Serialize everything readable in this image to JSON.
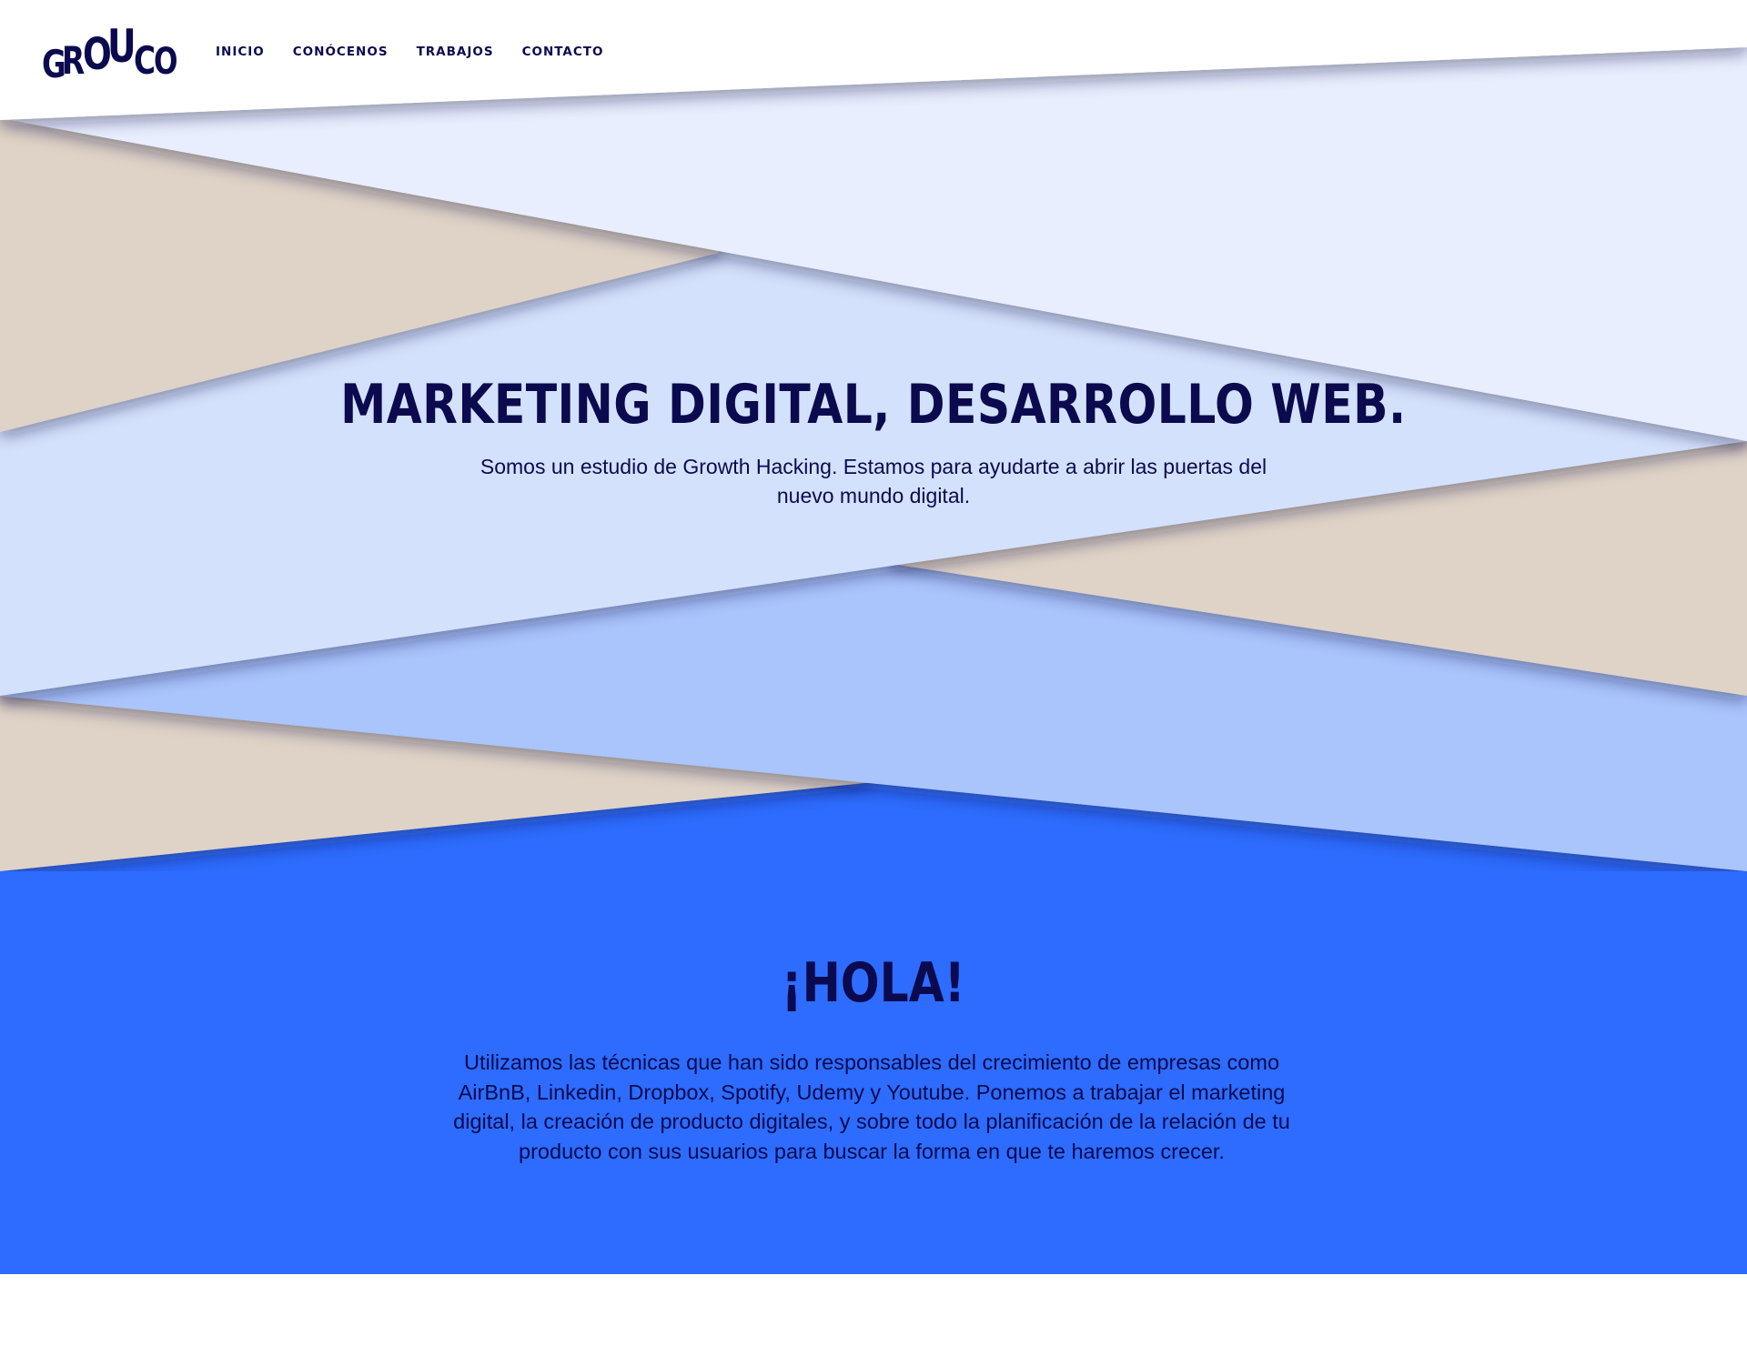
{
  "brand": {
    "logo_letters": [
      "G",
      "R",
      "O",
      "U",
      "C",
      "O"
    ]
  },
  "nav": {
    "items": [
      {
        "label": "INICIO"
      },
      {
        "label": "CONÓCENOS"
      },
      {
        "label": "TRABAJOS"
      },
      {
        "label": "CONTACTO"
      }
    ]
  },
  "hero": {
    "title": "MARKETING DIGITAL, DESARROLLO WEB.",
    "subtitle": "Somos un estudio de Growth Hacking. Estamos para ayudarte a abrir las puertas del nuevo mundo digital."
  },
  "hola": {
    "title": "¡HOLA!",
    "text": "Utilizamos las técnicas que han sido responsables del crecimiento de empresas como AirBnB, Linkedin, Dropbox, Spotify, Udemy y Youtube. Ponemos a trabajar el marketing digital, la creación de producto digitales, y sobre todo la planificación de la relación de tu producto con sus usuarios para buscar la forma en que te haremos crecer."
  },
  "colors": {
    "navy": "#0b0a4e",
    "blue": "#2d6cff",
    "light_blue": "#aac4fc",
    "pale_blue": "#d4e1fc",
    "palest_blue": "#e8eefe",
    "beige": "#dfd3c7"
  }
}
